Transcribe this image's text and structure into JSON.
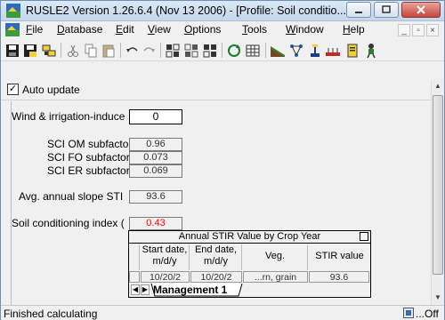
{
  "window": {
    "title": "RUSLE2 Version 1.26.6.4 (Nov 13 2006) - [Profile: Soil conditio..."
  },
  "menu": {
    "items": [
      "File",
      "Database",
      "Edit",
      "View",
      "Options",
      "Tools",
      "Window",
      "Help"
    ],
    "underline_letters": [
      "F",
      "D",
      "E",
      "V",
      "O",
      "T",
      "W",
      "H"
    ]
  },
  "toolbar": {
    "icons": [
      "save-icon",
      "save-as-icon",
      "link-icon",
      "cut-icon",
      "copy-icon",
      "paste-icon",
      "undo-icon",
      "redo-icon",
      "grid1-icon",
      "grid2-icon",
      "grid3-icon",
      "refresh-icon",
      "table-icon",
      "slope-icon",
      "network-icon",
      "mower-icon",
      "tillage-icon",
      "clipboard-icon",
      "person-icon"
    ]
  },
  "auto_update": {
    "label": "Auto update",
    "checked": true,
    "check_glyph": "✓"
  },
  "fields": {
    "wind_label": "Wind & irrigation-induce",
    "wind_value": "0",
    "sci_om_label": "SCI OM subfactor",
    "sci_om_value": "0.96",
    "sci_fo_label": "SCI FO subfactor",
    "sci_fo_value": "0.073",
    "sci_er_label": "SCI ER subfactor",
    "sci_er_value": "0.069",
    "avg_stir_label": "Avg. annual slope STI",
    "avg_stir_value": "93.6",
    "sci_label": "Soil conditioning index (",
    "sci_value": "0.43",
    "sci_value_color": "#ff0000"
  },
  "stir_table": {
    "title": "Annual STIR Value by Crop Year",
    "headers": {
      "start": [
        "Start date,",
        "m/d/y"
      ],
      "end": [
        "End date,",
        "m/d/y"
      ],
      "veg": "Veg.",
      "stir": "STIR value"
    },
    "row": {
      "start": "10/20/2",
      "end": "10/20/2",
      "veg": "...rn, grain",
      "stir": "93.6"
    },
    "tab": "Management 1"
  },
  "status": {
    "text": "Finished calculating",
    "right": "...Off"
  }
}
